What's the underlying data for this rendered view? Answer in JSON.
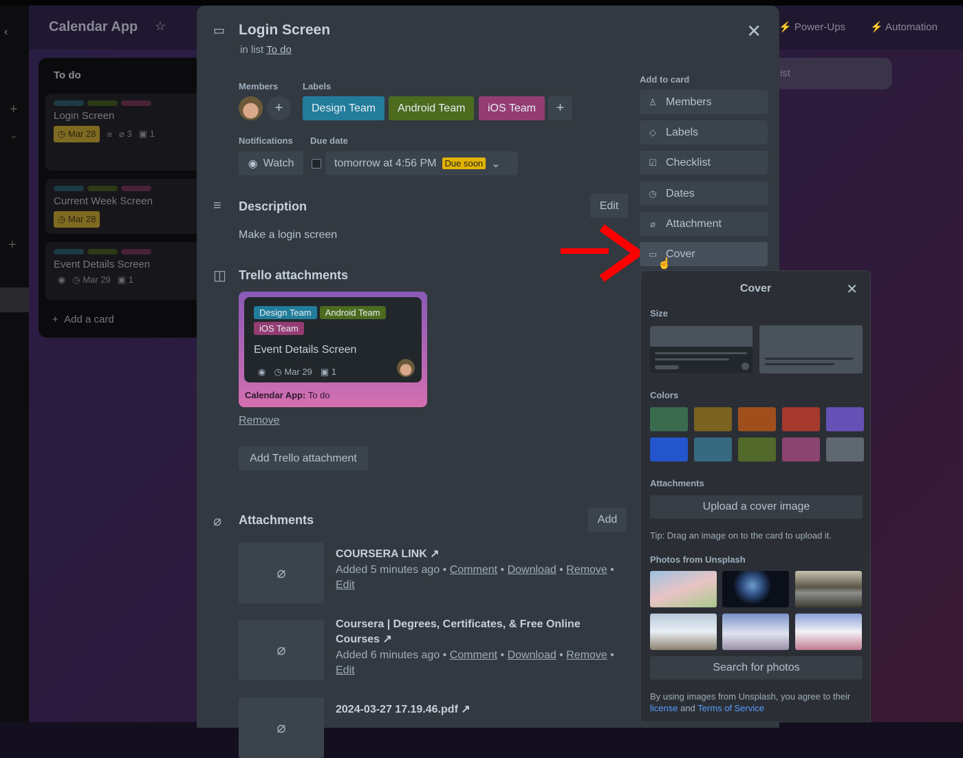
{
  "board": {
    "title": "Calendar App",
    "power_ups": "Power-Ups",
    "automation": "Automation",
    "add_list": "ist",
    "list": {
      "title": "To do",
      "add_card": "Add a card",
      "cards": [
        {
          "title": "Login Screen",
          "due": "Mar 28",
          "attachments": "3",
          "trello": "1"
        },
        {
          "title": "Current Week Screen",
          "due": "Mar 28"
        },
        {
          "title": "Event Details Screen",
          "due": "Mar 29",
          "trello": "1"
        }
      ]
    }
  },
  "modal": {
    "title": "Login Screen",
    "in_list_prefix": "in list",
    "list_name": "To do",
    "members_label": "Members",
    "labels_label": "Labels",
    "labels": [
      {
        "name": "Design Team",
        "color": "#227d9b"
      },
      {
        "name": "Android Team",
        "color": "#4c6b1f"
      },
      {
        "name": "iOS Team",
        "color": "#943d73"
      }
    ],
    "notifications_label": "Notifications",
    "watch": "Watch",
    "due_label": "Due date",
    "due_value": "tomorrow at 4:56 PM",
    "due_badge": "Due soon",
    "description_title": "Description",
    "edit": "Edit",
    "description": "Make a login screen",
    "trello_att_title": "Trello attachments",
    "trello_card": {
      "labels": [
        "Design Team",
        "Android Team",
        "iOS Team"
      ],
      "title": "Event Details Screen",
      "due": "Mar 29",
      "count": "1",
      "board": "Calendar App:",
      "list": "To do"
    },
    "remove": "Remove",
    "add_trello": "Add Trello attachment",
    "attachments_title": "Attachments",
    "add": "Add",
    "attachments": [
      {
        "name": "COURSERA LINK",
        "added": "Added 5 minutes ago",
        "comment": "Comment",
        "download": "Download",
        "remove": "Remove",
        "edit": "Edit"
      },
      {
        "name": "Coursera | Degrees, Certificates, & Free Online Courses",
        "added": "Added 6 minutes ago",
        "comment": "Comment",
        "download": "Download",
        "remove": "Remove",
        "edit": "Edit"
      },
      {
        "name": "2024-03-27 17.19.46.pdf"
      }
    ],
    "add_to_card": "Add to card",
    "side": [
      "Members",
      "Labels",
      "Checklist",
      "Dates",
      "Attachment",
      "Cover"
    ]
  },
  "cover": {
    "title": "Cover",
    "size": "Size",
    "colors_label": "Colors",
    "colors": [
      "#3a6b4f",
      "#7a6220",
      "#a04f1c",
      "#a7392e",
      "#6550b5",
      "#2355cc",
      "#376a80",
      "#52692b",
      "#8c4471",
      "#5f6870"
    ],
    "attachments": "Attachments",
    "upload": "Upload a cover image",
    "tip": "Tip: Drag an image on to the card to upload it.",
    "unsplash": "Photos from Unsplash",
    "search": "Search for photos",
    "footer_pre": "By using images from Unsplash, you agree to their",
    "license": "license",
    "and": "and",
    "tos": "Terms of Service"
  }
}
